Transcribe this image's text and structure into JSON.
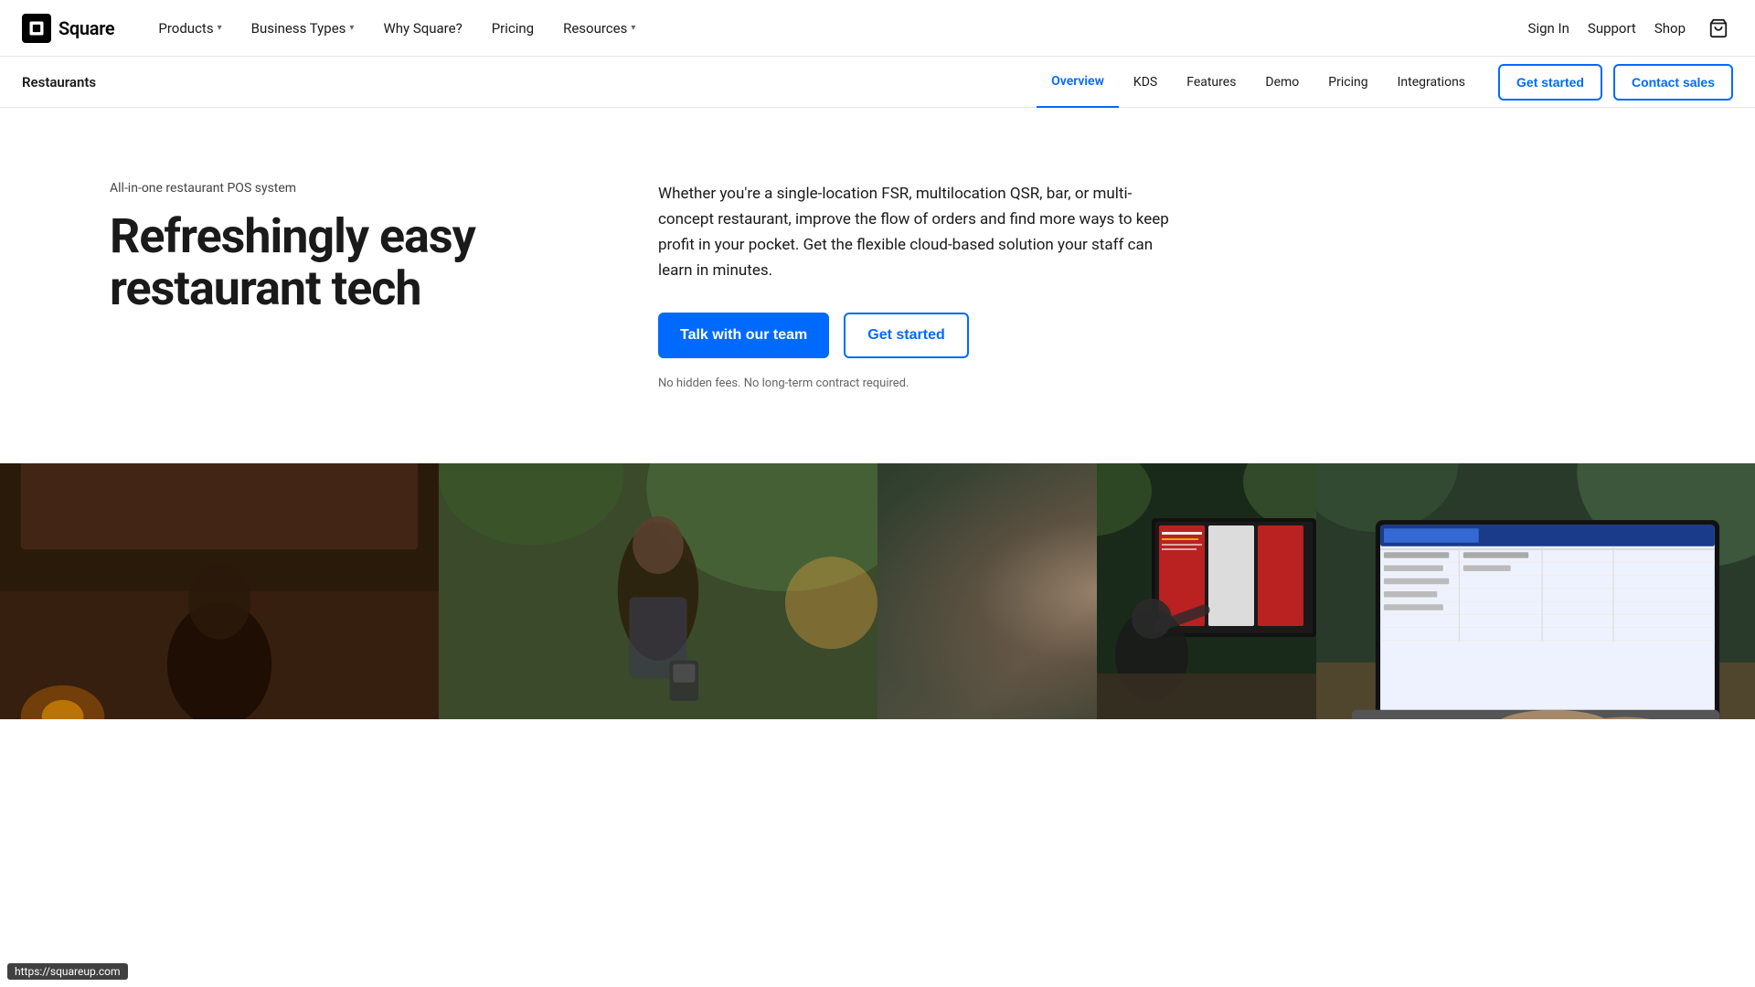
{
  "brand": {
    "name": "Square",
    "logo_alt": "Square logo"
  },
  "top_nav": {
    "items": [
      {
        "label": "Products",
        "has_dropdown": true
      },
      {
        "label": "Business Types",
        "has_dropdown": true
      },
      {
        "label": "Why Square?",
        "has_dropdown": false
      },
      {
        "label": "Pricing",
        "has_dropdown": false
      },
      {
        "label": "Resources",
        "has_dropdown": true
      }
    ],
    "right_links": [
      {
        "label": "Sign In"
      },
      {
        "label": "Support"
      },
      {
        "label": "Shop"
      }
    ]
  },
  "sub_nav": {
    "brand": "Restaurants",
    "links": [
      {
        "label": "Overview",
        "active": true
      },
      {
        "label": "KDS",
        "active": false
      },
      {
        "label": "Features",
        "active": false
      },
      {
        "label": "Demo",
        "active": false
      },
      {
        "label": "Pricing",
        "active": false
      },
      {
        "label": "Integrations",
        "active": false
      }
    ],
    "cta_primary": "Get started",
    "cta_secondary": "Contact sales"
  },
  "hero": {
    "subtitle": "All-in-one restaurant POS system",
    "title_line1": "Refreshingly easy",
    "title_line2": "restaurant tech",
    "body": "Whether you're a single-location FSR, multilocation QSR, bar, or multi-concept restaurant, improve the flow of orders and find more ways to keep profit in your pocket. Get the flexible cloud-based solution your staff can learn in minutes.",
    "cta_primary": "Talk with our team",
    "cta_secondary": "Get started",
    "footnote": "No hidden fees. No long-term contract required."
  },
  "url_bar": {
    "text": "https://squareup.com"
  }
}
